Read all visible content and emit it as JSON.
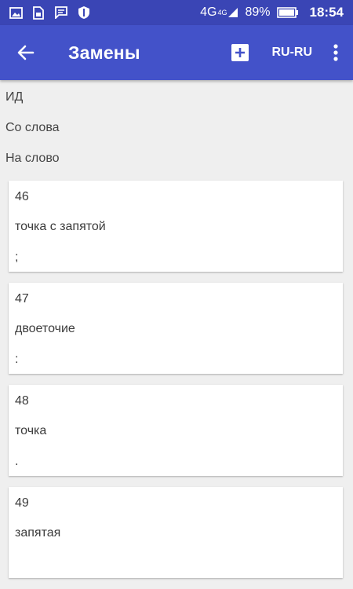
{
  "status_bar": {
    "network": "4G",
    "network_sup": "4G",
    "battery": "89%",
    "time": "18:54",
    "icons": [
      "image-icon",
      "sim-icon",
      "message-icon",
      "shield-icon",
      "signal-icon",
      "battery-icon"
    ]
  },
  "app_bar": {
    "title": "Замены",
    "language": "RU-RU",
    "icons": [
      "back-arrow-icon",
      "add-icon",
      "more-vert-icon"
    ],
    "color": "#4352c9"
  },
  "fields": {
    "id_label": "ИД",
    "from_label": "Со слова",
    "to_label": "На слово"
  },
  "items": [
    {
      "id": "46",
      "from": "точка с запятой",
      "to": ";"
    },
    {
      "id": "47",
      "from": "двоеточие",
      "to": ":"
    },
    {
      "id": "48",
      "from": "точка",
      "to": "."
    },
    {
      "id": "49",
      "from": "запятая",
      "to": ""
    }
  ]
}
